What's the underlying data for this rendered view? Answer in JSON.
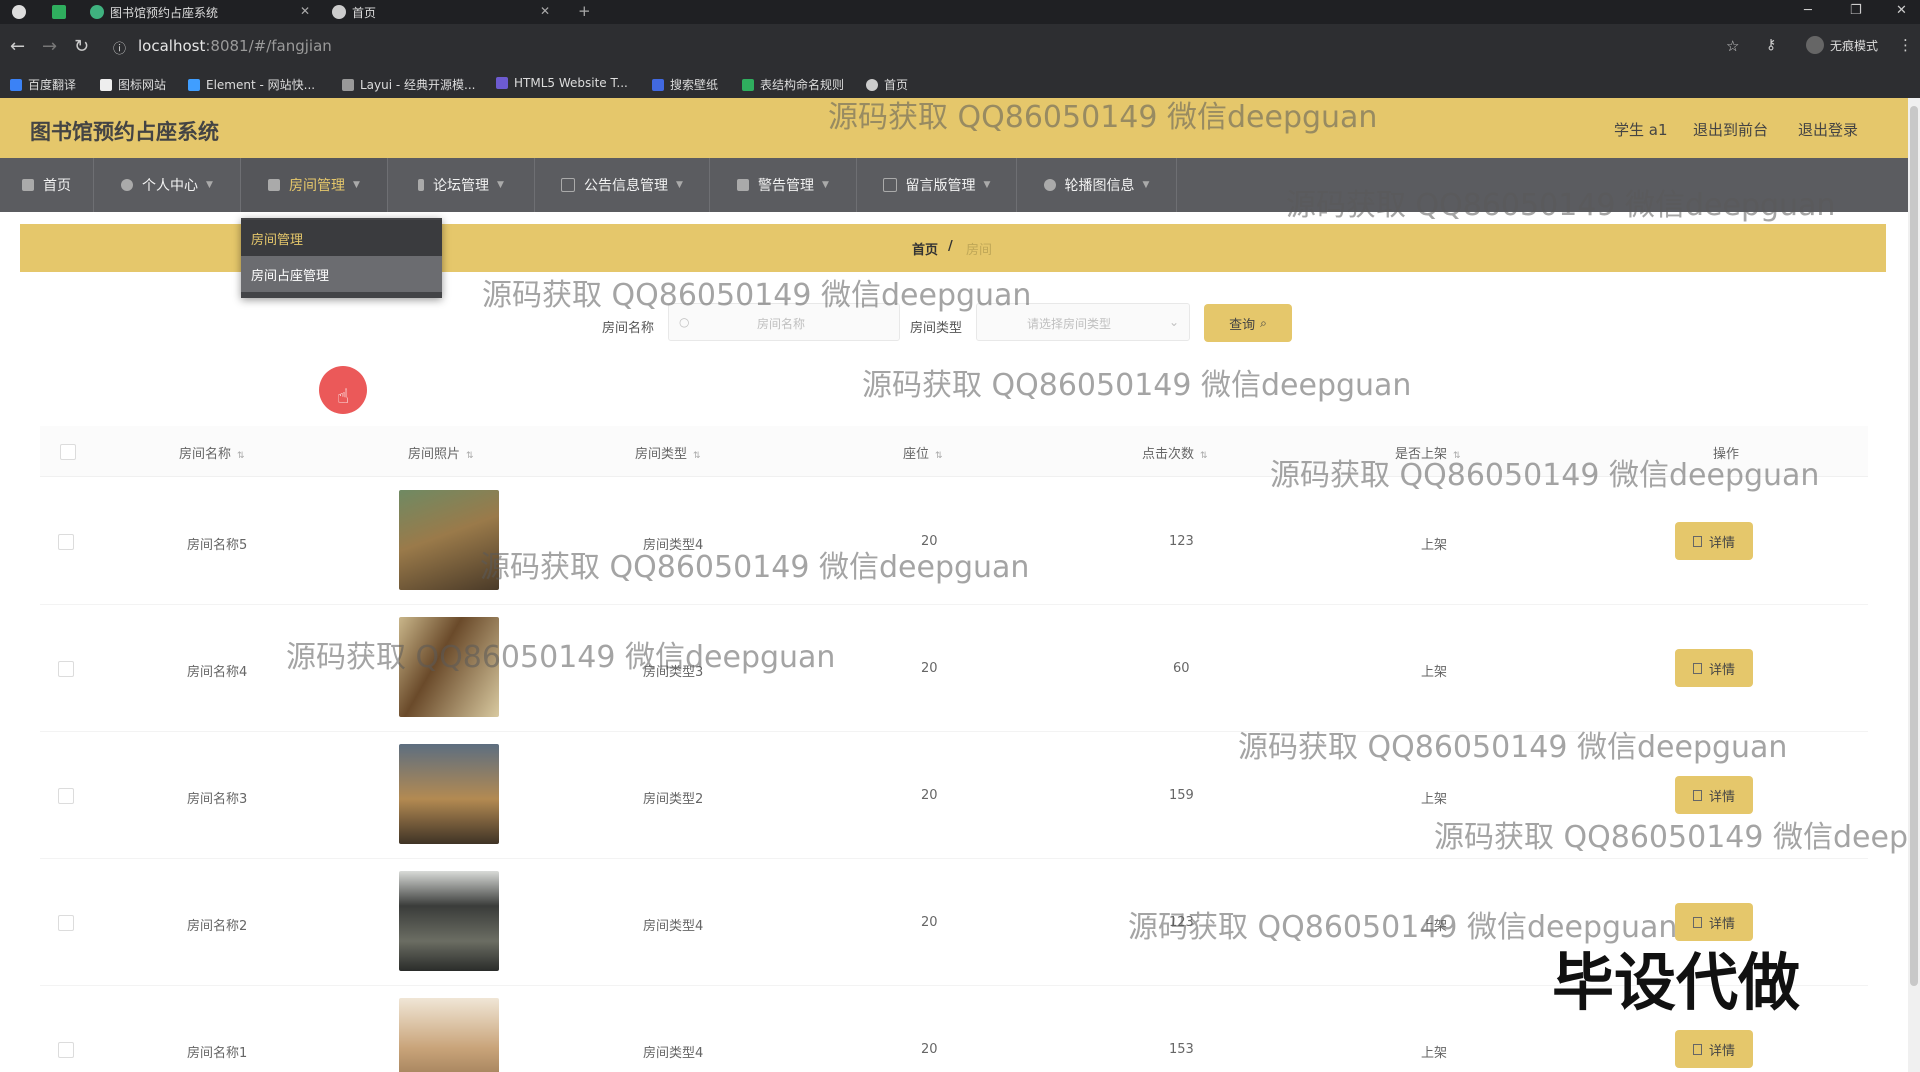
{
  "browser": {
    "tabs": [
      {
        "title": "图书馆预约占座系统"
      },
      {
        "title": "首页"
      }
    ],
    "new_tab_label": "+",
    "url_host": "localhost",
    "url_rest": ":8081/#/fangjian",
    "profile_label": "无痕模式",
    "bookmarks": [
      "百度翻译",
      "图标网站",
      "Element - 网站快...",
      "Layui - 经典开源模...",
      "HTML5 Website T...",
      "搜索壁纸",
      "表结构命名规则",
      "首页"
    ]
  },
  "header": {
    "title": "图书馆预约占座系统",
    "user": "学生 a1",
    "back_front": "退出到前台",
    "logout": "退出登录"
  },
  "nav": [
    {
      "label": "首页",
      "caret": false
    },
    {
      "label": "个人中心",
      "caret": true
    },
    {
      "label": "房间管理",
      "caret": true,
      "active": true
    },
    {
      "label": "论坛管理",
      "caret": true
    },
    {
      "label": "公告信息管理",
      "caret": true
    },
    {
      "label": "警告管理",
      "caret": true
    },
    {
      "label": "留言版管理",
      "caret": true
    },
    {
      "label": "轮播图信息",
      "caret": true
    }
  ],
  "dropdown": [
    "房间管理",
    "房间占座管理"
  ],
  "breadcrumb": {
    "home": "首页",
    "sep": "/",
    "current": "房间"
  },
  "search": {
    "name_label": "房间名称",
    "name_placeholder": "房间名称",
    "type_label": "房间类型",
    "type_placeholder": "请选择房间类型",
    "button": "查询"
  },
  "table": {
    "headers": [
      "房间名称",
      "房间照片",
      "房间类型",
      "座位",
      "点击次数",
      "是否上架",
      "操作"
    ],
    "rows": [
      {
        "name": "房间名称5",
        "type": "房间类型4",
        "seats": "20",
        "clicks": "123",
        "status": "上架",
        "action": "详情"
      },
      {
        "name": "房间名称4",
        "type": "房间类型3",
        "seats": "20",
        "clicks": "60",
        "status": "上架",
        "action": "详情"
      },
      {
        "name": "房间名称3",
        "type": "房间类型2",
        "seats": "20",
        "clicks": "159",
        "status": "上架",
        "action": "详情"
      },
      {
        "name": "房间名称2",
        "type": "房间类型4",
        "seats": "20",
        "clicks": "123",
        "status": "上架",
        "action": "详情"
      },
      {
        "name": "房间名称1",
        "type": "房间类型4",
        "seats": "20",
        "clicks": "153",
        "status": "上架",
        "action": "详情"
      }
    ]
  },
  "watermark_text": "源码获取 QQ86050149 微信deepguan",
  "corner_text": "毕设代做",
  "colors": {
    "accent": "#e5c76b",
    "nav": "#5b5c60"
  }
}
